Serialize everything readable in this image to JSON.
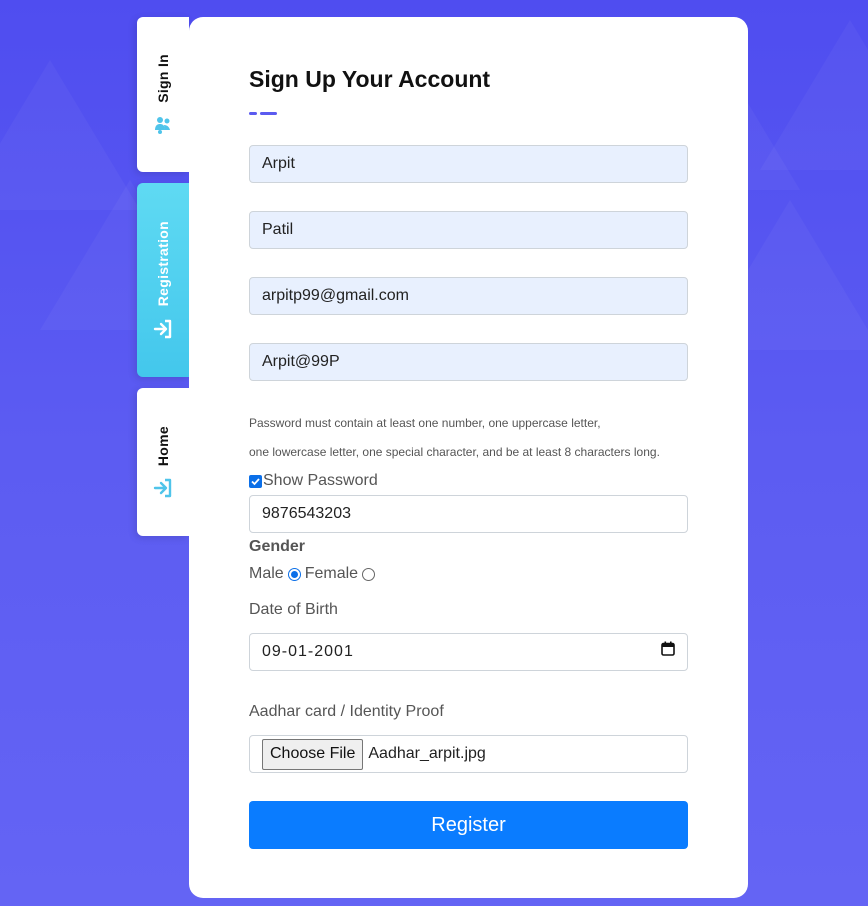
{
  "tabs": {
    "signin": {
      "label": "Sign In",
      "icon": "users-icon"
    },
    "registration": {
      "label": "Registration",
      "icon": "sign-in-icon"
    },
    "home": {
      "label": "Home",
      "icon": "sign-in-icon"
    }
  },
  "form": {
    "title": "Sign Up Your Account",
    "first_name": "Arpit",
    "last_name": "Patil",
    "email": "arpitp99@gmail.com",
    "password": "Arpit@99P",
    "password_hint_1": "Password must contain at least one number, one uppercase letter,",
    "password_hint_2": "one lowercase letter, one special character, and be at least 8 characters long.",
    "show_password_label": "Show Password",
    "show_password_checked": true,
    "phone": "9876543203",
    "gender_label": "Gender",
    "gender_male": "Male",
    "gender_female": "Female",
    "gender_selected": "Male",
    "dob_label": "Date of Birth",
    "dob_value": "09-01-2001",
    "id_proof_label": "Aadhar card / Identity Proof",
    "choose_file_label": "Choose File",
    "file_name": "Aadhar_arpit.jpg",
    "register_label": "Register"
  },
  "colors": {
    "background": "#5a5af2",
    "accent": "#0a7cff",
    "registration_tab": "#4fcff0",
    "autofill": "#e8f0fe"
  }
}
